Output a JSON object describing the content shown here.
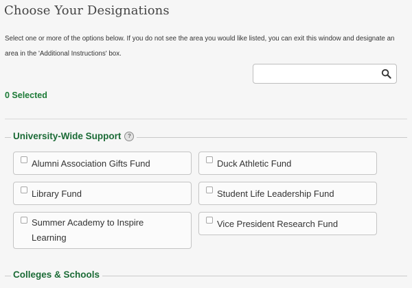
{
  "page": {
    "title": "Choose Your Designations",
    "instructions": "Select one or more of the options below. If you do not see the area you would like listed, you can exit this window and designate an area in the 'Additional Instructions' box.",
    "selected_count": "0 Selected"
  },
  "search": {
    "value": "",
    "placeholder": "",
    "icon": "search-icon"
  },
  "sections": [
    {
      "title": "University-Wide Support",
      "help_icon": "?",
      "options": [
        {
          "label": "Alumni Association Gifts Fund",
          "checked": false
        },
        {
          "label": "Duck Athletic Fund",
          "checked": false
        },
        {
          "label": "Library Fund",
          "checked": false
        },
        {
          "label": "Student Life Leadership Fund",
          "checked": false
        },
        {
          "label": "Summer Academy to Inspire Learning",
          "checked": false
        },
        {
          "label": "Vice President Research Fund",
          "checked": false
        }
      ]
    },
    {
      "title": "Colleges & Schools"
    }
  ],
  "colors": {
    "accent_green": "#1b7a36",
    "heading_green": "#1b6b36",
    "background": "#f6f6f6"
  }
}
